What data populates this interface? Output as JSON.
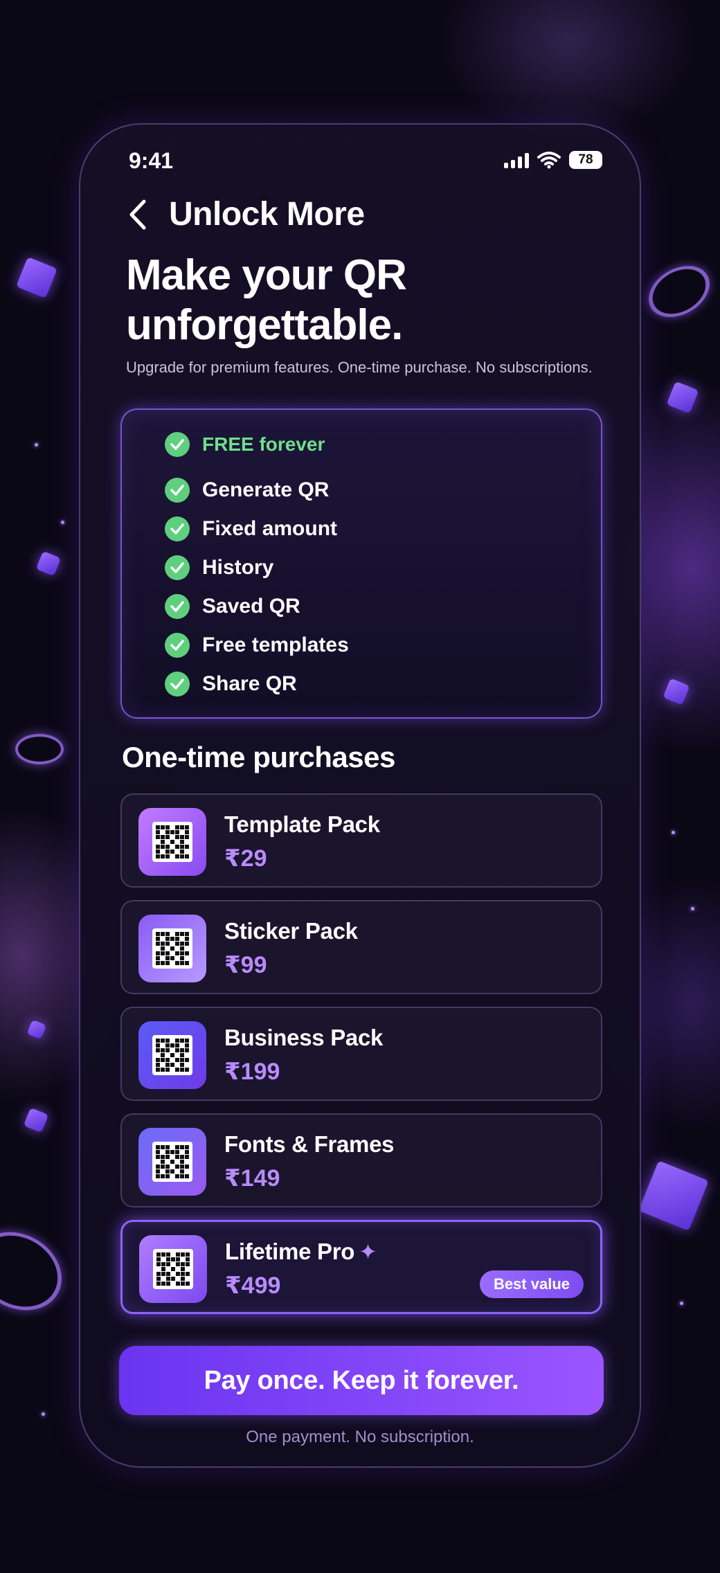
{
  "status_bar": {
    "time": "9:41",
    "battery": "78"
  },
  "nav": {
    "title": "Unlock More"
  },
  "hero": {
    "title": "Make your QR unforgettable.",
    "subtitle": "Upgrade for premium features. One-time purchase. No subscriptions."
  },
  "free_plan": {
    "heading": "FREE forever",
    "features": [
      "Generate QR",
      "Fixed amount",
      "History",
      "Saved QR",
      "Free templates",
      "Share QR"
    ]
  },
  "purchases": {
    "section_title": "One-time purchases",
    "items": [
      {
        "name": "Template Pack",
        "price": "₹29"
      },
      {
        "name": "Sticker Pack",
        "price": "₹99"
      },
      {
        "name": "Business Pack",
        "price": "₹199"
      },
      {
        "name": "Fonts & Frames",
        "price": "₹149"
      },
      {
        "name": "Lifetime Pro",
        "price": "₹499",
        "badge": "Best value"
      }
    ]
  },
  "cta": {
    "label": "Pay once. Keep it forever."
  },
  "footnote": "One payment. No subscription.",
  "colors": {
    "accent": "#8f63ff",
    "price": "#b98bff",
    "success": "#5fcf7e"
  }
}
